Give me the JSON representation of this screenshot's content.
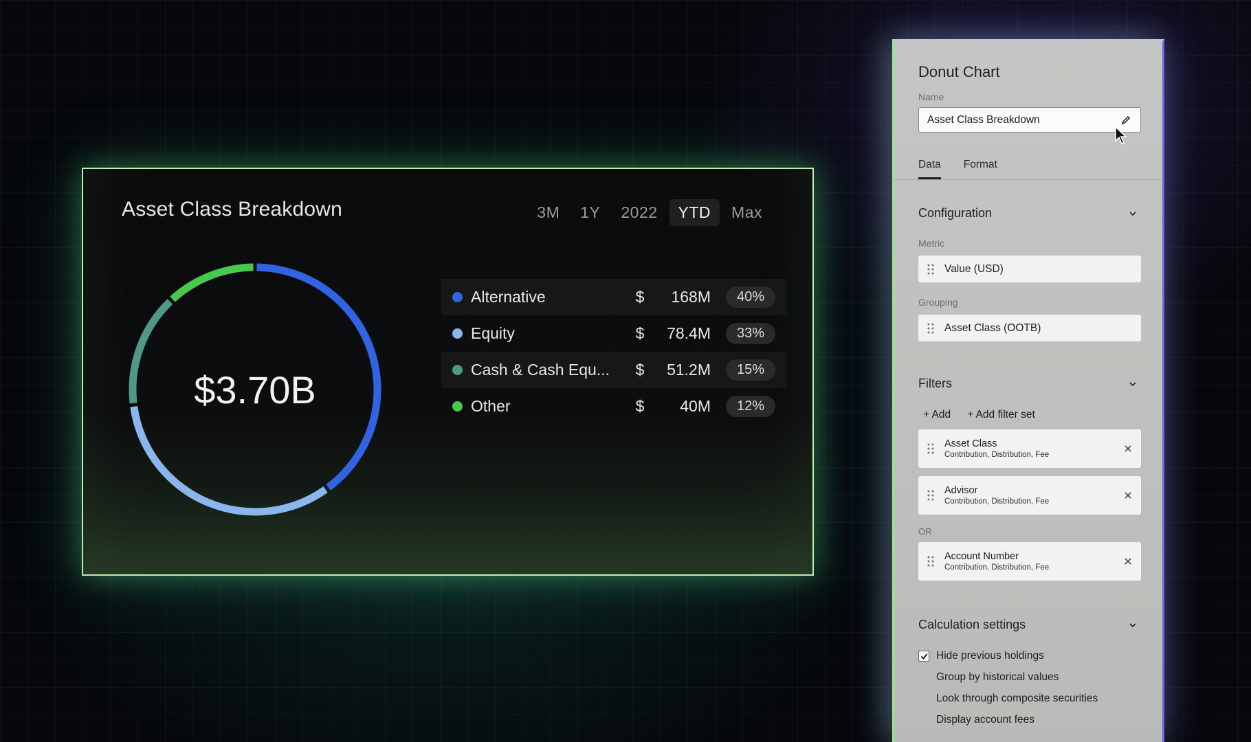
{
  "chart_card": {
    "title": "Asset Class Breakdown",
    "ranges": [
      "3M",
      "1Y",
      "2022",
      "YTD",
      "Max"
    ],
    "active_range": "YTD",
    "total": "$3.70B",
    "legend": [
      {
        "name": "Alternative",
        "currency": "$",
        "amount": "168M",
        "pct": "40%",
        "color": "#3064e2"
      },
      {
        "name": "Equity",
        "currency": "$",
        "amount": "78.4M",
        "pct": "33%",
        "color": "#8ab6ee"
      },
      {
        "name": "Cash & Cash Equ...",
        "currency": "$",
        "amount": "51.2M",
        "pct": "15%",
        "color": "#4e9a86"
      },
      {
        "name": "Other",
        "currency": "$",
        "amount": "40M",
        "pct": "12%",
        "color": "#47c94c"
      }
    ]
  },
  "chart_data": {
    "type": "pie",
    "variant": "donut",
    "title": "Asset Class Breakdown",
    "center_label": "$3.70B",
    "categories": [
      "Alternative",
      "Equity",
      "Cash & Cash Equ...",
      "Other"
    ],
    "values": [
      40,
      33,
      15,
      12
    ],
    "amounts": [
      "168M",
      "78.4M",
      "51.2M",
      "40M"
    ],
    "colors": [
      "#3064e2",
      "#8ab6ee",
      "#4e9a86",
      "#47c94c"
    ],
    "unit": "%"
  },
  "panel": {
    "heading": "Donut Chart",
    "name_label": "Name",
    "name_value": "Asset Class Breakdown",
    "tabs": [
      "Data",
      "Format"
    ],
    "active_tab": "Data",
    "configuration": {
      "title": "Configuration",
      "metric_label": "Metric",
      "metric_value": "Value (USD)",
      "grouping_label": "Grouping",
      "grouping_value": "Asset Class (OOTB)"
    },
    "filters": {
      "title": "Filters",
      "add_label": "+ Add",
      "add_set_label": "+ Add filter set",
      "items": [
        {
          "title": "Asset Class",
          "sub": "Contribution, Distribution, Fee"
        },
        {
          "title": "Advisor",
          "sub": "Contribution, Distribution, Fee"
        },
        {
          "title": "Account Number",
          "sub": "Contribution, Distribution, Fee"
        }
      ],
      "or_label": "OR"
    },
    "calculation": {
      "title": "Calculation settings",
      "options": [
        {
          "label": "Hide previous holdings",
          "checked": true
        },
        {
          "label": "Group by historical values",
          "checked": false
        },
        {
          "label": "Look through composite securities",
          "checked": false
        },
        {
          "label": "Display account fees",
          "checked": false
        }
      ]
    }
  }
}
